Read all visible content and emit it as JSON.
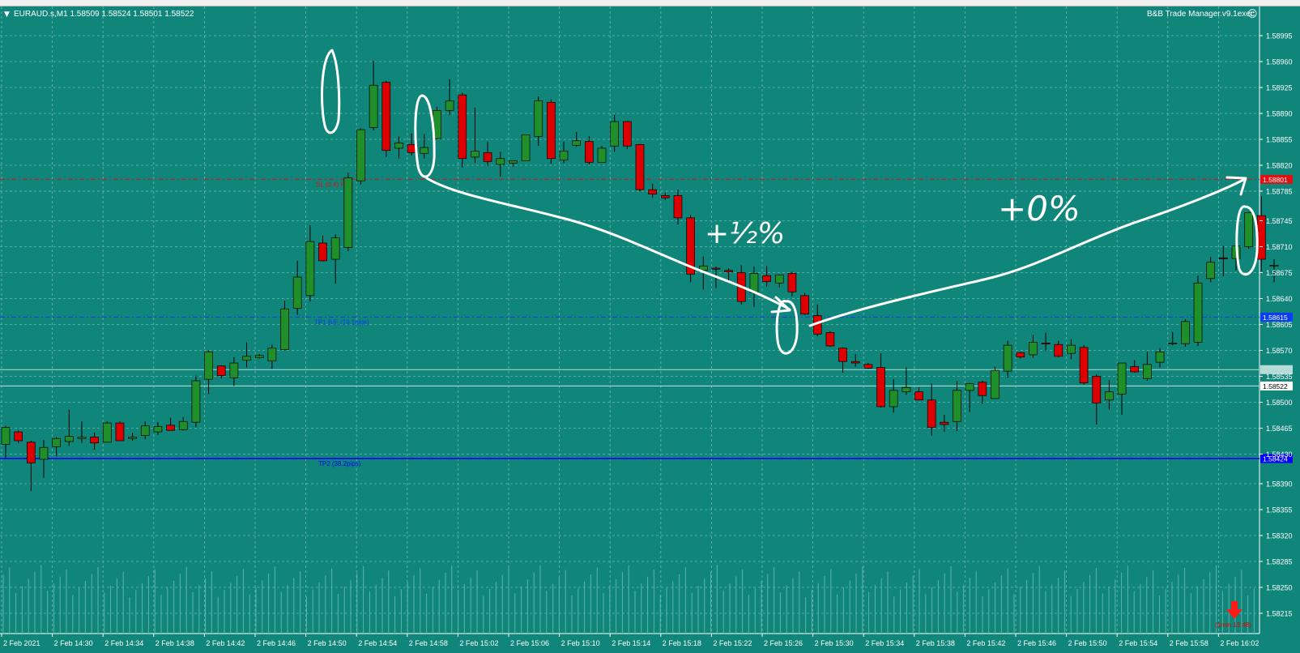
{
  "window": {
    "symbol_header": "EURAUD.s,M1  1.58509 1.58524 1.58501 1.58522",
    "expert_label": "B&B Trade Manager.v9.1exec",
    "dropdown_glyph": "▼",
    "smiley_glyph": "☺"
  },
  "colors": {
    "background": "#10857a",
    "grid": "#6fb9b0",
    "axis_text": "#ffffff",
    "bull_candle": "#1f8f2a",
    "bear_candle": "#dc0000",
    "wick": "#000000",
    "volume": "#5fb3aa",
    "sl_line": "#e01010",
    "tp1_line": "#0a3cf0",
    "tp2_line": "#0000ff",
    "ann_white": "#ffffff"
  },
  "chart_data": {
    "type": "candlestick",
    "timeframe": "M1",
    "y_ticks": [
      1.58995,
      1.5896,
      1.58925,
      1.5889,
      1.58855,
      1.5882,
      1.58785,
      1.58745,
      1.5871,
      1.58675,
      1.5864,
      1.58605,
      1.5857,
      1.58535,
      1.585,
      1.58465,
      1.5843,
      1.5839,
      1.58355,
      1.5832,
      1.58285,
      1.5825,
      1.58215
    ],
    "ylim": [
      1.58205,
      1.59025
    ],
    "x_ticks": [
      "2 Feb 2021",
      "2 Feb 14:30",
      "2 Feb 14:34",
      "2 Feb 14:38",
      "2 Feb 14:42",
      "2 Feb 14:46",
      "2 Feb 14:50",
      "2 Feb 14:54",
      "2 Feb 14:58",
      "2 Feb 15:02",
      "2 Feb 15:06",
      "2 Feb 15:10",
      "2 Feb 15:14",
      "2 Feb 15:18",
      "2 Feb 15:22",
      "2 Feb 15:26",
      "2 Feb 15:30",
      "2 Feb 15:34",
      "2 Feb 15:38",
      "2 Feb 15:42",
      "2 Feb 15:46",
      "2 Feb 15:50",
      "2 Feb 15:54",
      "2 Feb 15:58",
      "2 Feb 16:02"
    ],
    "candles": [
      {
        "o": 1.58443,
        "h": 1.58468,
        "l": 1.58425,
        "c": 1.58466
      },
      {
        "o": 1.5846,
        "h": 1.58462,
        "l": 1.58445,
        "c": 1.58448
      },
      {
        "o": 1.58446,
        "h": 1.58448,
        "l": 1.5838,
        "c": 1.58418
      },
      {
        "o": 1.58423,
        "h": 1.58449,
        "l": 1.58398,
        "c": 1.58439
      },
      {
        "o": 1.5844,
        "h": 1.58453,
        "l": 1.58427,
        "c": 1.58451
      },
      {
        "o": 1.58447,
        "h": 1.5849,
        "l": 1.58441,
        "c": 1.58454
      },
      {
        "o": 1.58451,
        "h": 1.58474,
        "l": 1.58445,
        "c": 1.58453
      },
      {
        "o": 1.58453,
        "h": 1.58459,
        "l": 1.58436,
        "c": 1.58445
      },
      {
        "o": 1.58446,
        "h": 1.58474,
        "l": 1.58446,
        "c": 1.58472
      },
      {
        "o": 1.58472,
        "h": 1.58474,
        "l": 1.58448,
        "c": 1.58448
      },
      {
        "o": 1.58451,
        "h": 1.58459,
        "l": 1.58448,
        "c": 1.58453
      },
      {
        "o": 1.58455,
        "h": 1.58474,
        "l": 1.5845,
        "c": 1.58468
      },
      {
        "o": 1.5846,
        "h": 1.58473,
        "l": 1.58456,
        "c": 1.58467
      },
      {
        "o": 1.58469,
        "h": 1.58479,
        "l": 1.58465,
        "c": 1.58462
      },
      {
        "o": 1.58463,
        "h": 1.5848,
        "l": 1.58462,
        "c": 1.58474
      },
      {
        "o": 1.58473,
        "h": 1.58536,
        "l": 1.58466,
        "c": 1.58529
      },
      {
        "o": 1.58531,
        "h": 1.5857,
        "l": 1.58511,
        "c": 1.58568
      },
      {
        "o": 1.58549,
        "h": 1.5855,
        "l": 1.58532,
        "c": 1.58536
      },
      {
        "o": 1.58533,
        "h": 1.58561,
        "l": 1.58522,
        "c": 1.58553
      },
      {
        "o": 1.58557,
        "h": 1.58581,
        "l": 1.58547,
        "c": 1.58562
      },
      {
        "o": 1.5856,
        "h": 1.58565,
        "l": 1.58559,
        "c": 1.58563
      },
      {
        "o": 1.58556,
        "h": 1.58578,
        "l": 1.58545,
        "c": 1.58573
      },
      {
        "o": 1.58571,
        "h": 1.58637,
        "l": 1.5857,
        "c": 1.58626
      },
      {
        "o": 1.58627,
        "h": 1.58691,
        "l": 1.58618,
        "c": 1.58669
      },
      {
        "o": 1.58644,
        "h": 1.58739,
        "l": 1.58636,
        "c": 1.58717
      },
      {
        "o": 1.58715,
        "h": 1.58725,
        "l": 1.5869,
        "c": 1.58691
      },
      {
        "o": 1.58693,
        "h": 1.58727,
        "l": 1.5866,
        "c": 1.58722
      },
      {
        "o": 1.58709,
        "h": 1.5881,
        "l": 1.58704,
        "c": 1.58803
      },
      {
        "o": 1.58799,
        "h": 1.5887,
        "l": 1.58794,
        "c": 1.58868
      },
      {
        "o": 1.58871,
        "h": 1.58961,
        "l": 1.58867,
        "c": 1.58928
      },
      {
        "o": 1.58932,
        "h": 1.58934,
        "l": 1.58831,
        "c": 1.5884
      },
      {
        "o": 1.58843,
        "h": 1.58859,
        "l": 1.58829,
        "c": 1.5885
      },
      {
        "o": 1.58848,
        "h": 1.58863,
        "l": 1.58833,
        "c": 1.58837
      },
      {
        "o": 1.58836,
        "h": 1.58862,
        "l": 1.58829,
        "c": 1.58844
      },
      {
        "o": 1.58856,
        "h": 1.58899,
        "l": 1.58855,
        "c": 1.58894
      },
      {
        "o": 1.58894,
        "h": 1.58936,
        "l": 1.58888,
        "c": 1.58907
      },
      {
        "o": 1.58915,
        "h": 1.58918,
        "l": 1.58817,
        "c": 1.58829
      },
      {
        "o": 1.58831,
        "h": 1.58898,
        "l": 1.58823,
        "c": 1.58839
      },
      {
        "o": 1.58837,
        "h": 1.58852,
        "l": 1.58819,
        "c": 1.58825
      },
      {
        "o": 1.58821,
        "h": 1.58838,
        "l": 1.58805,
        "c": 1.58829
      },
      {
        "o": 1.58823,
        "h": 1.58825,
        "l": 1.58818,
        "c": 1.58826
      },
      {
        "o": 1.58826,
        "h": 1.58861,
        "l": 1.58826,
        "c": 1.58861
      },
      {
        "o": 1.58859,
        "h": 1.58913,
        "l": 1.58846,
        "c": 1.58907
      },
      {
        "o": 1.58905,
        "h": 1.58909,
        "l": 1.58822,
        "c": 1.58829
      },
      {
        "o": 1.58827,
        "h": 1.58852,
        "l": 1.58823,
        "c": 1.58839
      },
      {
        "o": 1.58847,
        "h": 1.58865,
        "l": 1.58845,
        "c": 1.58853
      },
      {
        "o": 1.58852,
        "h": 1.58859,
        "l": 1.58821,
        "c": 1.58824
      },
      {
        "o": 1.58824,
        "h": 1.58846,
        "l": 1.58825,
        "c": 1.58843
      },
      {
        "o": 1.58846,
        "h": 1.58888,
        "l": 1.58838,
        "c": 1.58879
      },
      {
        "o": 1.58879,
        "h": 1.5888,
        "l": 1.58842,
        "c": 1.58846
      },
      {
        "o": 1.58848,
        "h": 1.58849,
        "l": 1.58785,
        "c": 1.58787
      },
      {
        "o": 1.58787,
        "h": 1.58795,
        "l": 1.58776,
        "c": 1.58781
      },
      {
        "o": 1.58779,
        "h": 1.58783,
        "l": 1.58773,
        "c": 1.58776
      },
      {
        "o": 1.58779,
        "h": 1.58787,
        "l": 1.5874,
        "c": 1.58749
      },
      {
        "o": 1.58749,
        "h": 1.58753,
        "l": 1.58662,
        "c": 1.58673
      },
      {
        "o": 1.58678,
        "h": 1.58697,
        "l": 1.58652,
        "c": 1.58684
      },
      {
        "o": 1.58681,
        "h": 1.58683,
        "l": 1.58654,
        "c": 1.5868
      },
      {
        "o": 1.58678,
        "h": 1.58681,
        "l": 1.58664,
        "c": 1.58676
      },
      {
        "o": 1.58675,
        "h": 1.58685,
        "l": 1.58632,
        "c": 1.58636
      },
      {
        "o": 1.58648,
        "h": 1.58683,
        "l": 1.58629,
        "c": 1.58674
      },
      {
        "o": 1.58671,
        "h": 1.58684,
        "l": 1.58656,
        "c": 1.58663
      },
      {
        "o": 1.58661,
        "h": 1.58672,
        "l": 1.58655,
        "c": 1.58672
      },
      {
        "o": 1.58674,
        "h": 1.58676,
        "l": 1.58643,
        "c": 1.58649
      },
      {
        "o": 1.58644,
        "h": 1.58648,
        "l": 1.58618,
        "c": 1.58619
      },
      {
        "o": 1.58617,
        "h": 1.58632,
        "l": 1.58589,
        "c": 1.58592
      },
      {
        "o": 1.58594,
        "h": 1.58596,
        "l": 1.58575,
        "c": 1.58576
      },
      {
        "o": 1.58573,
        "h": 1.58574,
        "l": 1.5854,
        "c": 1.58555
      },
      {
        "o": 1.58555,
        "h": 1.58565,
        "l": 1.58548,
        "c": 1.58553
      },
      {
        "o": 1.58551,
        "h": 1.58553,
        "l": 1.58545,
        "c": 1.58546
      },
      {
        "o": 1.58547,
        "h": 1.58566,
        "l": 1.58493,
        "c": 1.58494
      },
      {
        "o": 1.58494,
        "h": 1.58531,
        "l": 1.58486,
        "c": 1.58516
      },
      {
        "o": 1.58514,
        "h": 1.58547,
        "l": 1.5851,
        "c": 1.5852
      },
      {
        "o": 1.58514,
        "h": 1.5852,
        "l": 1.58503,
        "c": 1.58503
      },
      {
        "o": 1.58503,
        "h": 1.58525,
        "l": 1.58455,
        "c": 1.58466
      },
      {
        "o": 1.58473,
        "h": 1.58483,
        "l": 1.5846,
        "c": 1.5847
      },
      {
        "o": 1.58474,
        "h": 1.58529,
        "l": 1.58461,
        "c": 1.58516
      },
      {
        "o": 1.58516,
        "h": 1.58526,
        "l": 1.58487,
        "c": 1.58525
      },
      {
        "o": 1.58527,
        "h": 1.58529,
        "l": 1.58498,
        "c": 1.58509
      },
      {
        "o": 1.58505,
        "h": 1.58548,
        "l": 1.58505,
        "c": 1.58543
      },
      {
        "o": 1.58542,
        "h": 1.58583,
        "l": 1.58533,
        "c": 1.58577
      },
      {
        "o": 1.58567,
        "h": 1.58568,
        "l": 1.58559,
        "c": 1.58561
      },
      {
        "o": 1.58564,
        "h": 1.58591,
        "l": 1.5856,
        "c": 1.58581
      },
      {
        "o": 1.5858,
        "h": 1.58594,
        "l": 1.58569,
        "c": 1.58579
      },
      {
        "o": 1.58578,
        "h": 1.58583,
        "l": 1.58561,
        "c": 1.58562
      },
      {
        "o": 1.58566,
        "h": 1.58585,
        "l": 1.58558,
        "c": 1.58577
      },
      {
        "o": 1.58574,
        "h": 1.58577,
        "l": 1.58524,
        "c": 1.58526
      },
      {
        "o": 1.58535,
        "h": 1.58538,
        "l": 1.5847,
        "c": 1.58499
      },
      {
        "o": 1.58503,
        "h": 1.5853,
        "l": 1.5849,
        "c": 1.58514
      },
      {
        "o": 1.58511,
        "h": 1.58553,
        "l": 1.58483,
        "c": 1.58553
      },
      {
        "o": 1.58548,
        "h": 1.58557,
        "l": 1.5854,
        "c": 1.58541
      },
      {
        "o": 1.58532,
        "h": 1.58568,
        "l": 1.58529,
        "c": 1.58551
      },
      {
        "o": 1.58554,
        "h": 1.58573,
        "l": 1.58547,
        "c": 1.58568
      },
      {
        "o": 1.58579,
        "h": 1.58595,
        "l": 1.58577,
        "c": 1.5858
      },
      {
        "o": 1.58579,
        "h": 1.58612,
        "l": 1.58575,
        "c": 1.58609
      },
      {
        "o": 1.58581,
        "h": 1.58671,
        "l": 1.58576,
        "c": 1.58661
      },
      {
        "o": 1.58667,
        "h": 1.58696,
        "l": 1.58662,
        "c": 1.58689
      },
      {
        "o": 1.58695,
        "h": 1.58711,
        "l": 1.5867,
        "c": 1.58694
      },
      {
        "o": 1.58694,
        "h": 1.58721,
        "l": 1.58678,
        "c": 1.58711
      },
      {
        "o": 1.5871,
        "h": 1.58757,
        "l": 1.58707,
        "c": 1.58756
      },
      {
        "o": 1.58752,
        "h": 1.58778,
        "l": 1.58677,
        "c": 1.58693
      },
      {
        "o": 1.58685,
        "h": 1.58693,
        "l": 1.58662,
        "c": 1.58685
      }
    ],
    "volume_note": "tick volume histogram along bottom of chart",
    "levels": [
      {
        "name": "SL",
        "price": 1.58801,
        "label": "SL (0.4) Pips",
        "price_label": "1.58801"
      },
      {
        "name": "TP1",
        "price": 1.58615,
        "label": "TP1 B/E (19.1pips)",
        "price_label": "1.58615"
      },
      {
        "name": "bid",
        "price": 1.58522,
        "label": "",
        "price_label": "1.58522"
      },
      {
        "name": "ask",
        "price": 1.58544,
        "label": "",
        "price_label": "1.58544"
      },
      {
        "name": "TP2",
        "price": 1.58424,
        "label": "TP2 (38.2pips)",
        "price_label": "1.58424"
      }
    ],
    "annotations": [
      {
        "text": "+½%"
      },
      {
        "text": "+0%"
      }
    ],
    "timer_label": "(1min 13:48)"
  }
}
